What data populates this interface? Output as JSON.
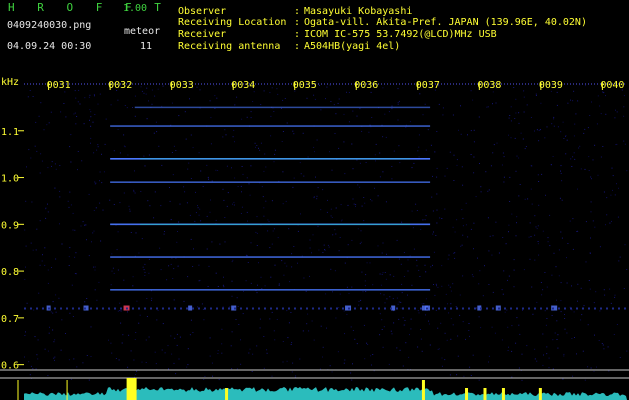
{
  "header": {
    "brand": "H R O F F T",
    "version": "1.00",
    "filename": "0409240030.png",
    "meteor_label": "meteor",
    "datetime": "04.09.24 00:30",
    "meteor_count": "11"
  },
  "info": [
    {
      "key": "Observer",
      "value": "Masayuki Kobayashi"
    },
    {
      "key": "Receiving Location",
      "value": "Ogata-vill. Akita-Pref. JAPAN (139.96E, 40.02N)"
    },
    {
      "key": "Receiver",
      "value": "ICOM IC-575 53.7492(@LCD)MHz USB"
    },
    {
      "key": "Receiving antenna",
      "value": "A504HB(yagi 4el)"
    }
  ],
  "colors": {
    "header_text": "#ffff33",
    "brand_text": "#3fd23f",
    "meta_text": "#e8e8e8",
    "background": "#000000",
    "trace": "#4a78ff",
    "trace_bright": "#22ddaa",
    "histogram": "#33dddd",
    "histogram_peaks": "#ffff22"
  },
  "chart_data": {
    "type": "heatmap",
    "ylabel": "kHz",
    "y_ticks": [
      "1.1",
      "1.0",
      "0.9",
      "0.8",
      "0.7",
      "0.6"
    ],
    "y_tick_values": [
      1.1,
      1.0,
      0.9,
      0.8,
      0.7,
      0.6
    ],
    "x_ticks": [
      "0031",
      "0032",
      "0033",
      "0034",
      "0035",
      "0036",
      "0037",
      "0038",
      "0039",
      "0040"
    ],
    "x_tick_values": [
      31,
      32,
      33,
      34,
      35,
      36,
      37,
      38,
      39,
      40
    ],
    "xlim": [
      30.6,
      40.4
    ],
    "ylim": [
      0.58,
      1.2
    ],
    "carrier_lines": [
      {
        "freq": 1.15,
        "start": 32.4,
        "end": 37.2,
        "intensity": 0.4
      },
      {
        "freq": 1.11,
        "start": 32.0,
        "end": 37.2,
        "intensity": 0.6
      },
      {
        "freq": 1.04,
        "start": 32.0,
        "end": 37.2,
        "intensity": 1.0
      },
      {
        "freq": 0.99,
        "start": 32.0,
        "end": 37.2,
        "intensity": 0.6
      },
      {
        "freq": 0.9,
        "start": 32.0,
        "end": 37.2,
        "intensity": 0.9
      },
      {
        "freq": 0.83,
        "start": 32.0,
        "end": 37.2,
        "intensity": 0.7
      },
      {
        "freq": 0.76,
        "start": 32.0,
        "end": 37.2,
        "intensity": 0.7
      }
    ],
    "meteor_echoes_x": [
      31.0,
      31.6,
      32.25,
      33.3,
      34.0,
      35.85,
      36.6,
      37.15,
      37.1,
      38.0,
      38.3,
      39.2
    ],
    "echo_freq": 0.72,
    "histogram_peaks_x": [
      32.3,
      37.1,
      38.1,
      38.4,
      39.0,
      33.9,
      37.8
    ],
    "grid": false,
    "legend": "none"
  }
}
